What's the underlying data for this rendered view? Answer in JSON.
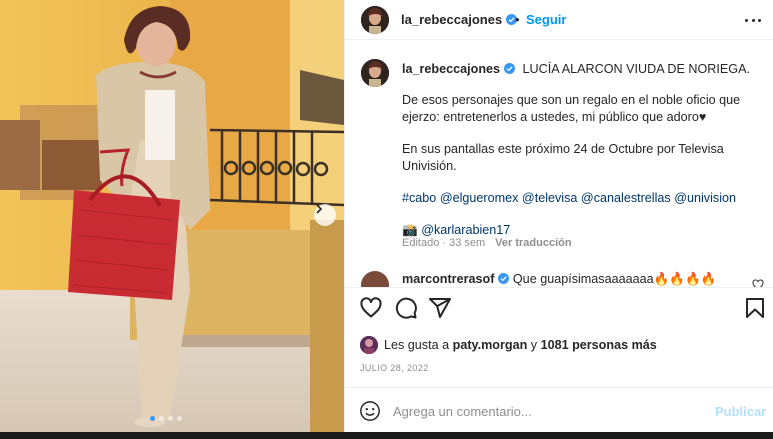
{
  "post": {
    "author": "la_rebeccajones",
    "separator": "•",
    "follow_label": "Seguir",
    "more_icon": "more-options-icon",
    "carousel": {
      "slide_count": 4,
      "active_index": 0
    }
  },
  "caption": {
    "username": "la_rebeccajones",
    "title": "LUCÍA ALARCON VIUDA DE NORIEGA.",
    "paragraph1": "De esos personajes que son un regalo en el noble oficio que ejerzo: entretenerlos a ustedes, mi público que adoro♥",
    "paragraph2": "En sus pantallas este próximo 24 de Octubre por Televisa Univisión.",
    "hashtags": [
      "#cabo",
      "@elgueromex",
      "@televisa",
      "@canalestrellas",
      "@univision"
    ],
    "camera_emoji": "📸",
    "photo_credit": "@karlarabien17",
    "edited": "Editado · 33 sem",
    "translate": "Ver traducción"
  },
  "comments": [
    {
      "username": "marcontrerasof",
      "text": "Que guapísimasaaaaaaa🔥🔥🔥🔥"
    }
  ],
  "actions": {
    "like_icon": "heart-icon",
    "comment_icon": "comment-icon",
    "share_icon": "share-icon",
    "save_icon": "bookmark-icon"
  },
  "likes": {
    "prefix": "Les gusta a",
    "first_user": "paty.morgan",
    "connector": "y",
    "others": "1081 personas más"
  },
  "date": "JULIO 28, 2022",
  "add_comment": {
    "emoji_icon": "smiley-icon",
    "placeholder": "Agrega un comentario...",
    "publish_label": "Publicar"
  },
  "colors": {
    "accent": "#0095f6",
    "link": "#00376b",
    "muted": "#8e8e8e",
    "publish_disabled": "#b2dffc",
    "verified": "#3897f0",
    "bag_red": "#c8232c"
  }
}
